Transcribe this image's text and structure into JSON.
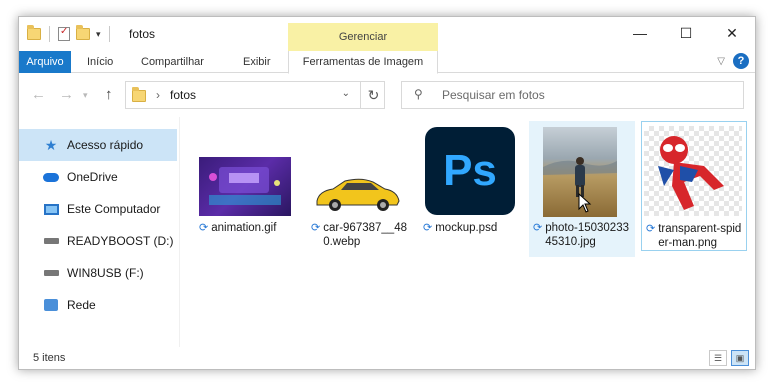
{
  "window": {
    "title": "fotos",
    "context_group": "Gerenciar",
    "controls": {
      "minimize": "—",
      "maximize": "☐",
      "close": "✕"
    }
  },
  "ribbon": {
    "tabs": [
      "Arquivo",
      "Início",
      "Compartilhar",
      "Exibir",
      "Ferramentas de Imagem"
    ],
    "help": "?"
  },
  "address": {
    "path": "fotos",
    "separator": "›"
  },
  "search": {
    "placeholder": "Pesquisar em fotos"
  },
  "sidebar": {
    "items": [
      {
        "label": "Acesso rápido",
        "icon": "star-icon"
      },
      {
        "label": "OneDrive",
        "icon": "cloud-icon"
      },
      {
        "label": "Este Computador",
        "icon": "computer-icon"
      },
      {
        "label": "READYBOOST (D:)",
        "icon": "drive-icon"
      },
      {
        "label": "WIN8USB (F:)",
        "icon": "drive-icon"
      },
      {
        "label": "Rede",
        "icon": "network-icon"
      }
    ]
  },
  "files": [
    {
      "name": "animation.gif"
    },
    {
      "name": "car-967387__480.webp"
    },
    {
      "name": "mockup.psd",
      "thumb_text": "Ps"
    },
    {
      "name": "photo-1503023345310.jpg"
    },
    {
      "name": "transparent-spider-man.png"
    }
  ],
  "status": {
    "count": "5 itens"
  },
  "colors": {
    "accent": "#1979ca",
    "selection": "#cce4f7",
    "context": "#f9f1a5",
    "ps_blue": "#31a8ff",
    "ps_bg": "#001e36"
  }
}
